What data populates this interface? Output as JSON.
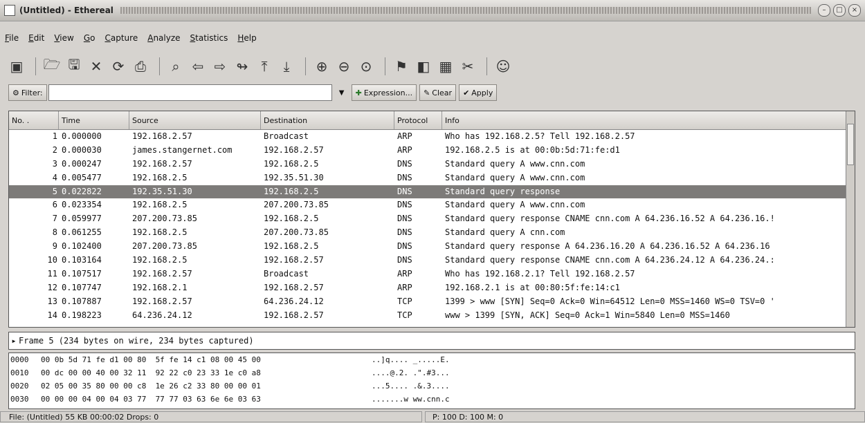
{
  "window": {
    "title": "(Untitled) - Ethereal"
  },
  "menu": [
    {
      "label": "File",
      "u": "F",
      "rest": "ile"
    },
    {
      "label": "Edit",
      "u": "E",
      "rest": "dit"
    },
    {
      "label": "View",
      "u": "V",
      "rest": "iew"
    },
    {
      "label": "Go",
      "u": "G",
      "rest": "o"
    },
    {
      "label": "Capture",
      "u": "C",
      "rest": "apture"
    },
    {
      "label": "Analyze",
      "u": "A",
      "rest": "nalyze"
    },
    {
      "label": "Statistics",
      "u": "S",
      "rest": "tatistics"
    },
    {
      "label": "Help",
      "u": "H",
      "rest": "elp"
    }
  ],
  "filter": {
    "label": "Filter:",
    "value": "",
    "expression_label": "Expression...",
    "clear_label": "Clear",
    "apply_label": "Apply"
  },
  "columns": [
    "No. .",
    "Time",
    "Source",
    "Destination",
    "Protocol",
    "Info"
  ],
  "packets": [
    {
      "no": "1",
      "time": "0.000000",
      "src": "192.168.2.57",
      "dst": "Broadcast",
      "proto": "ARP",
      "info": "Who has 192.168.2.5?  Tell 192.168.2.57"
    },
    {
      "no": "2",
      "time": "0.000030",
      "src": "james.stangernet.com",
      "dst": "192.168.2.57",
      "proto": "ARP",
      "info": "192.168.2.5 is at 00:0b:5d:71:fe:d1"
    },
    {
      "no": "3",
      "time": "0.000247",
      "src": "192.168.2.57",
      "dst": "192.168.2.5",
      "proto": "DNS",
      "info": "Standard query A www.cnn.com"
    },
    {
      "no": "4",
      "time": "0.005477",
      "src": "192.168.2.5",
      "dst": "192.35.51.30",
      "proto": "DNS",
      "info": "Standard query A www.cnn.com"
    },
    {
      "no": "5",
      "time": "0.022822",
      "src": "192.35.51.30",
      "dst": "192.168.2.5",
      "proto": "DNS",
      "info": "Standard query response",
      "selected": true
    },
    {
      "no": "6",
      "time": "0.023354",
      "src": "192.168.2.5",
      "dst": "207.200.73.85",
      "proto": "DNS",
      "info": "Standard query A www.cnn.com"
    },
    {
      "no": "7",
      "time": "0.059977",
      "src": "207.200.73.85",
      "dst": "192.168.2.5",
      "proto": "DNS",
      "info": "Standard query response CNAME cnn.com A 64.236.16.52 A 64.236.16.!"
    },
    {
      "no": "8",
      "time": "0.061255",
      "src": "192.168.2.5",
      "dst": "207.200.73.85",
      "proto": "DNS",
      "info": "Standard query A cnn.com"
    },
    {
      "no": "9",
      "time": "0.102400",
      "src": "207.200.73.85",
      "dst": "192.168.2.5",
      "proto": "DNS",
      "info": "Standard query response A 64.236.16.20 A 64.236.16.52 A 64.236.16"
    },
    {
      "no": "10",
      "time": "0.103164",
      "src": "192.168.2.5",
      "dst": "192.168.2.57",
      "proto": "DNS",
      "info": "Standard query response CNAME cnn.com A 64.236.24.12 A 64.236.24.:"
    },
    {
      "no": "11",
      "time": "0.107517",
      "src": "192.168.2.57",
      "dst": "Broadcast",
      "proto": "ARP",
      "info": "Who has 192.168.2.1?  Tell 192.168.2.57"
    },
    {
      "no": "12",
      "time": "0.107747",
      "src": "192.168.2.1",
      "dst": "192.168.2.57",
      "proto": "ARP",
      "info": "192.168.2.1 is at 00:80:5f:fe:14:c1"
    },
    {
      "no": "13",
      "time": "0.107887",
      "src": "192.168.2.57",
      "dst": "64.236.24.12",
      "proto": "TCP",
      "info": "1399 > www [SYN] Seq=0 Ack=0 Win=64512 Len=0 MSS=1460 WS=0 TSV=0 '"
    },
    {
      "no": "14",
      "time": "0.198223",
      "src": "64.236.24.12",
      "dst": "192.168.2.57",
      "proto": "TCP",
      "info": "www > 1399 [SYN, ACK] Seq=0 Ack=1 Win=5840 Len=0 MSS=1460"
    }
  ],
  "details": {
    "frame": "Frame 5 (234 bytes on wire, 234 bytes captured)"
  },
  "hex": [
    {
      "off": "0000",
      "bytes": "00 0b 5d 71 fe d1 00 80  5f fe 14 c1 08 00 45 00",
      "ascii": "..]q.... _.....E."
    },
    {
      "off": "0010",
      "bytes": "00 dc 00 00 40 00 32 11  92 22 c0 23 33 1e c0 a8",
      "ascii": "....@.2. .\".#3..."
    },
    {
      "off": "0020",
      "bytes": "02 05 00 35 80 00 00 c8  1e 26 c2 33 80 00 00 01",
      "ascii": "...5.... .&.3...."
    },
    {
      "off": "0030",
      "bytes": "00 00 00 04 00 04 03 77  77 77 03 63 6e 6e 03 63",
      "ascii": ".......w ww.cnn.c"
    }
  ],
  "status": {
    "left": "File: (Untitled) 55 KB 00:00:02 Drops: 0",
    "right": "P: 100 D: 100 M: 0"
  },
  "toolbar_icons": [
    "interfaces-icon",
    "open-icon",
    "save-icon",
    "close-icon",
    "reload-icon",
    "print-icon",
    "find-icon",
    "back-icon",
    "forward-icon",
    "goto-icon",
    "first-icon",
    "last-icon",
    "zoom-in-icon",
    "zoom-out-icon",
    "zoom-reset-icon",
    "capture-filter-icon",
    "display-filter-icon",
    "coloring-icon",
    "preferences-icon",
    "help-icon"
  ]
}
